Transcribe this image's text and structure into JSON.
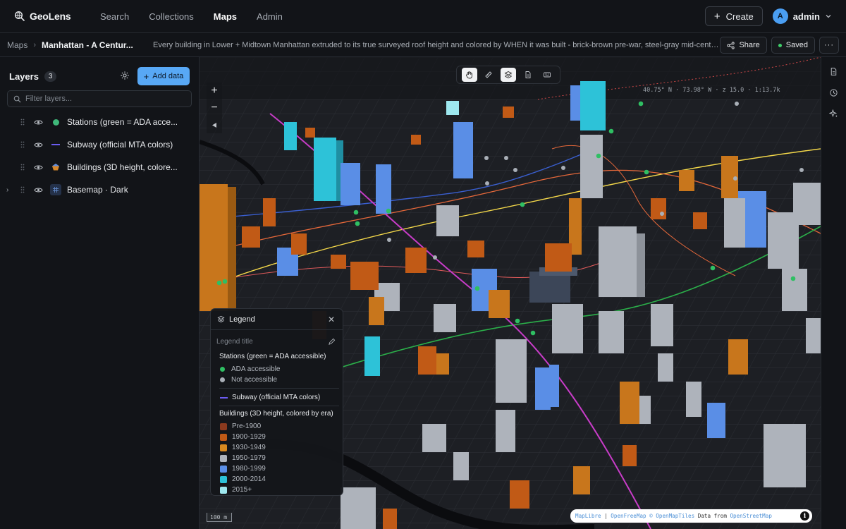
{
  "app": {
    "name": "GeoLens"
  },
  "nav": {
    "items": [
      "Search",
      "Collections",
      "Maps",
      "Admin"
    ],
    "active": "Maps"
  },
  "header": {
    "create_label": "Create",
    "user_initial": "A",
    "username": "admin"
  },
  "breadcrumb": {
    "root": "Maps",
    "title": "Manhattan - A Centur...",
    "description": "Every building in Lower + Midtown Manhattan extruded to its true surveyed roof height and colored by WHEN it was built - brick-brown pre-war, steel-gray mid-century, glass-blue...",
    "share_label": "Share",
    "saved_label": "Saved"
  },
  "sidebar": {
    "title": "Layers",
    "count": "3",
    "add_data_label": "Add data",
    "filter_placeholder": "Filter layers...",
    "layers": [
      {
        "name": "Stations (green = ADA acce...",
        "symbol": "dot",
        "color": "#3fb87a"
      },
      {
        "name": "Subway (official MTA colors)",
        "symbol": "line",
        "color": "#6a5cf0"
      },
      {
        "name": "Buildings (3D height, colore...",
        "symbol": "polygon",
        "color": "#d7872a"
      },
      {
        "name": "Basemap · Dark",
        "symbol": "grid",
        "color": "#4a6fa5"
      }
    ]
  },
  "map": {
    "coordinates": "40.75° N · 73.98° W · z 15.0 · 1:13.7k",
    "scale": "100 m",
    "attribution": {
      "a": "MapLibre",
      "sep": " | ",
      "b": "OpenFreeMap © OpenMapTiles",
      "c": " Data from ",
      "d": "OpenStreetMap"
    },
    "zoom_in": "+",
    "zoom_out": "−"
  },
  "legend": {
    "header": "Legend",
    "title_placeholder": "Legend title",
    "stations_title": "Stations (green = ADA accessible)",
    "stations": [
      {
        "label": "ADA accessible",
        "color": "#2fbf63"
      },
      {
        "label": "Not accessible",
        "color": "#a9afb7"
      }
    ],
    "subway_label": "Subway (official MTA colors)",
    "subway_color": "#6c5cf2",
    "buildings_title": "Buildings (3D height, colored by era)",
    "eras": [
      {
        "label": "Pre-1900",
        "color": "#8b3a1e"
      },
      {
        "label": "1900-1929",
        "color": "#c15a16"
      },
      {
        "label": "1930-1949",
        "color": "#d98a20"
      },
      {
        "label": "1950-1979",
        "color": "#aeb3bb"
      },
      {
        "label": "1980-1999",
        "color": "#5a8ee6"
      },
      {
        "label": "2000-2014",
        "color": "#2dc2d8"
      },
      {
        "label": "2015+",
        "color": "#9ee8ef"
      }
    ]
  }
}
